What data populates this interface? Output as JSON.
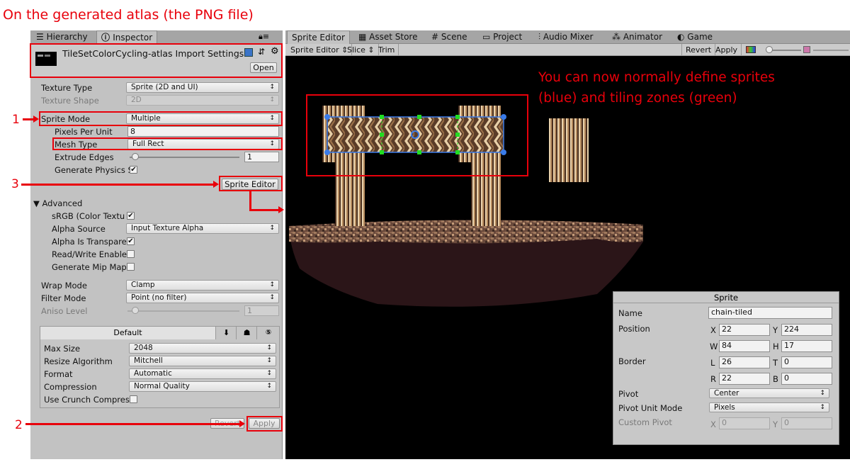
{
  "annotations": {
    "title": "On the generated atlas (the PNG file)",
    "canvas_note": "You can now normally define sprites (blue) and tiling zones (green)",
    "num1": "1",
    "num2": "2",
    "num3": "3"
  },
  "inspector": {
    "tabs": [
      {
        "label": "Hierarchy",
        "icon": "hierarchy-icon"
      },
      {
        "label": "Inspector",
        "icon": "info-icon"
      }
    ],
    "header_title": "TileSetColorCycling-atlas Import Settings",
    "open_label": "Open",
    "texture_type_label": "Texture Type",
    "texture_type_value": "Sprite (2D and UI)",
    "texture_shape_label": "Texture Shape",
    "texture_shape_value": "2D",
    "sprite_mode_label": "Sprite Mode",
    "sprite_mode_value": "Multiple",
    "ppu_label": "Pixels Per Unit",
    "ppu_value": "8",
    "mesh_type_label": "Mesh Type",
    "mesh_type_value": "Full Rect",
    "extrude_label": "Extrude Edges",
    "extrude_value": "1",
    "gen_physics_label": "Generate Physics S",
    "gen_physics_checked": true,
    "sprite_editor_button": "Sprite Editor",
    "advanced_label": "Advanced",
    "srgb_label": "sRGB (Color Textu",
    "srgb_checked": true,
    "alpha_source_label": "Alpha Source",
    "alpha_source_value": "Input Texture Alpha",
    "alpha_transp_label": "Alpha Is Transpare",
    "alpha_transp_checked": true,
    "readwrite_label": "Read/Write Enable",
    "readwrite_checked": false,
    "mipmaps_label": "Generate Mip Maps",
    "mipmaps_checked": false,
    "wrap_label": "Wrap Mode",
    "wrap_value": "Clamp",
    "filter_label": "Filter Mode",
    "filter_value": "Point (no filter)",
    "aniso_label": "Aniso Level",
    "aniso_value": "1",
    "platform_default": "Default",
    "max_size_label": "Max Size",
    "max_size_value": "2048",
    "resize_label": "Resize Algorithm",
    "resize_value": "Mitchell",
    "format_label": "Format",
    "format_value": "Automatic",
    "compression_label": "Compression",
    "compression_value": "Normal Quality",
    "crunch_label": "Use Crunch Compres",
    "crunch_checked": false,
    "revert_label": "Revert",
    "apply_label": "Apply"
  },
  "editor": {
    "tabs": [
      {
        "label": "Sprite Editor",
        "icon": ""
      },
      {
        "label": "Asset Store",
        "icon": "store-icon"
      },
      {
        "label": "Scene",
        "icon": "scene-icon"
      },
      {
        "label": "Project",
        "icon": "folder-icon"
      },
      {
        "label": "Audio Mixer",
        "icon": "mixer-icon"
      },
      {
        "label": "Animator",
        "icon": "animator-icon"
      },
      {
        "label": "Game",
        "icon": "game-icon"
      }
    ],
    "toolbar": {
      "mode": "Sprite Editor",
      "slice": "Slice",
      "trim": "Trim",
      "revert": "Revert",
      "apply": "Apply"
    },
    "sprite_panel": {
      "title": "Sprite",
      "name_label": "Name",
      "name_value": "chain-tiled",
      "position_label": "Position",
      "x_label": "X",
      "x_value": "22",
      "y_label": "Y",
      "y_value": "224",
      "w_label": "W",
      "w_value": "84",
      "h_label": "H",
      "h_value": "17",
      "border_label": "Border",
      "l_label": "L",
      "l_value": "26",
      "t_label": "T",
      "t_value": "0",
      "r_label": "R",
      "r_value": "22",
      "b_label": "B",
      "b_value": "0",
      "pivot_label": "Pivot",
      "pivot_value": "Center",
      "pivot_unit_label": "Pivot Unit Mode",
      "pivot_unit_value": "Pixels",
      "custom_pivot_label": "Custom Pivot",
      "cx_label": "X",
      "cx_value": "0",
      "cy_label": "Y",
      "cy_value": "0"
    }
  },
  "colors": {
    "annotation_red": "#e8000b",
    "sprite_rect_blue": "#3a7be8",
    "tiling_green": "#22dd22"
  }
}
